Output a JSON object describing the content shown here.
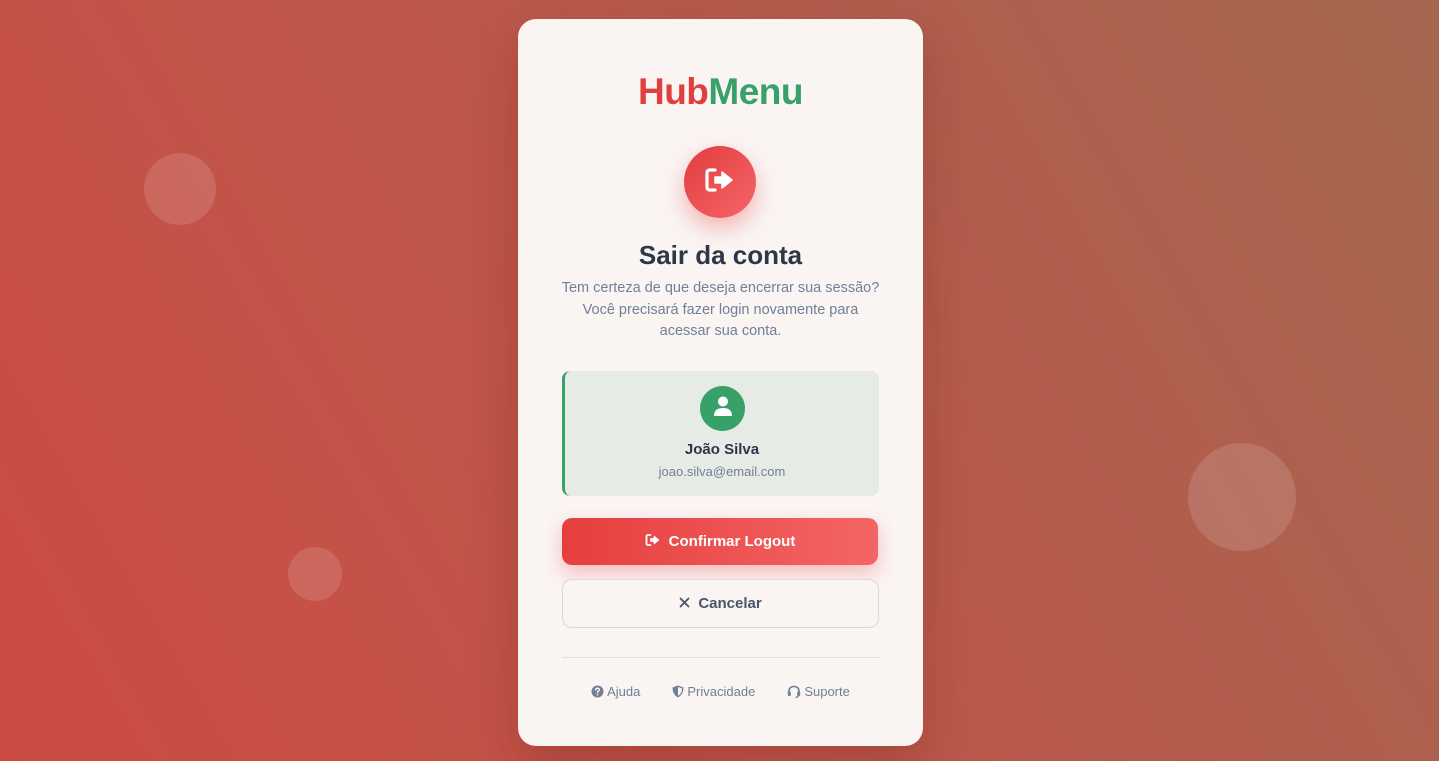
{
  "brand": {
    "part1": "Hub",
    "part2": "Menu",
    "color_part1": "#e03f3f",
    "color_part2": "#38a169"
  },
  "header": {
    "icon": "logout-icon",
    "title": "Sair da conta",
    "description": "Tem certeza de que deseja encerrar sua sessão? Você precisará fazer login novamente para acessar sua conta."
  },
  "user": {
    "icon": "user-icon",
    "name": "João Silva",
    "email": "joao.silva@email.com"
  },
  "actions": {
    "confirm_label": "Confirmar Logout",
    "confirm_icon": "logout-icon",
    "cancel_label": "Cancelar",
    "cancel_icon": "close-icon"
  },
  "footer": {
    "links": [
      {
        "label": "Ajuda",
        "icon": "help-icon"
      },
      {
        "label": "Privacidade",
        "icon": "shield-icon"
      },
      {
        "label": "Suporte",
        "icon": "headset-icon"
      }
    ]
  },
  "colors": {
    "danger": "#e53e3e",
    "success": "#38a169",
    "text_dark": "#2d3748",
    "text_muted": "#718096"
  }
}
